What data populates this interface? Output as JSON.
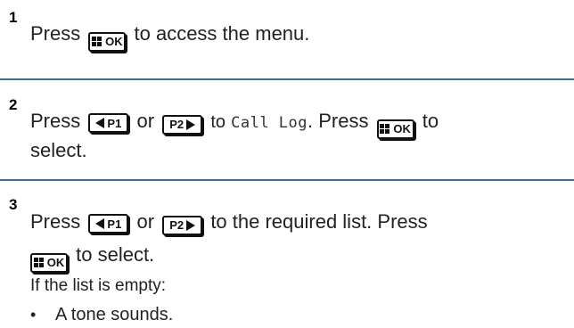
{
  "colors": {
    "divider": "#3d6f95",
    "text": "#222222"
  },
  "steps": [
    {
      "number": "1",
      "parts": [
        "Press",
        "to access the menu."
      ]
    },
    {
      "number": "2",
      "parts": [
        "Press",
        "or",
        "to",
        "Call Log",
        ". Press",
        "to",
        "select."
      ]
    },
    {
      "number": "3",
      "parts": [
        "Press",
        "or",
        "to the required list. Press",
        "to select."
      ],
      "note": "If the list is empty:",
      "bullets": [
        "A tone sounds."
      ]
    }
  ],
  "keys": {
    "menu_ok": "OK",
    "p1": "P1",
    "p2": "P2"
  },
  "icons": {
    "menu_ok": "menu-ok-key-icon",
    "p1": "p1-left-key-icon",
    "p2": "p2-right-key-icon"
  },
  "bullet_char": "•"
}
